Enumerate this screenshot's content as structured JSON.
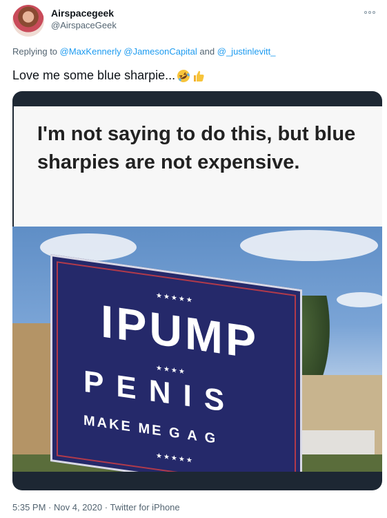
{
  "author": {
    "display_name": "Airspacegeek",
    "handle": "@AirspaceGeek"
  },
  "reply": {
    "prefix": "Replying to",
    "mentions": [
      "@MaxKennerly",
      "@JamesonCapital",
      "@_justinlevitt_"
    ],
    "conjunction": "and"
  },
  "tweet": {
    "text": "Love me some blue sharpie...",
    "emojis": [
      "rolling-on-floor-laughing-emoji",
      "thumbs-up-emoji"
    ]
  },
  "media": {
    "caption": "I'm not saying to do this, but blue sharpies are not expensive.",
    "sign_line_1": "IPUMP",
    "sign_line_2": "PENIS",
    "sign_line_3": "MAKE ME    G A G"
  },
  "meta": {
    "time": "5:35 PM",
    "separator": "·",
    "date": "Nov 4, 2020",
    "source": "Twitter for iPhone"
  },
  "colors": {
    "link": "#1d9bf0",
    "muted": "#536471",
    "sign_blue": "#25296a"
  }
}
